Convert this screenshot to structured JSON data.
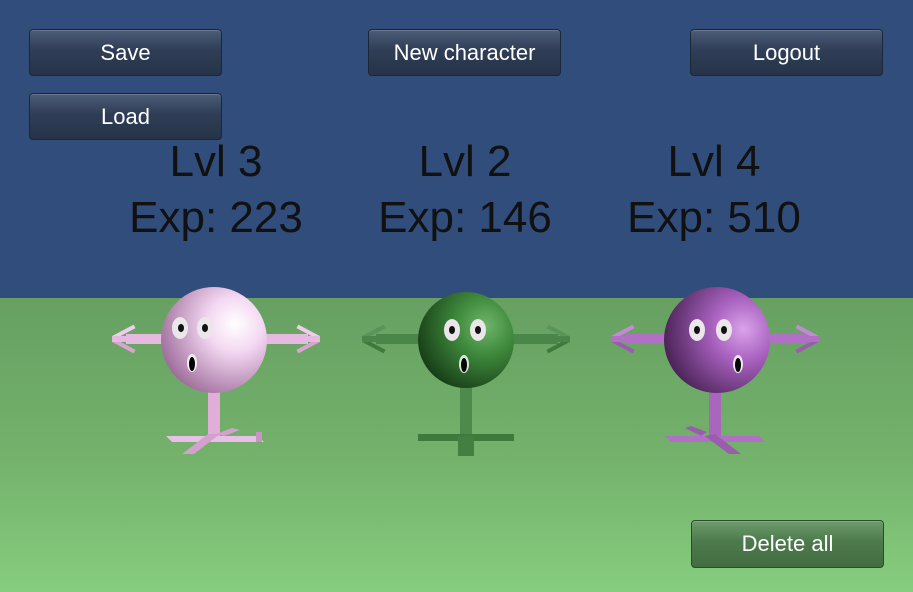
{
  "menu": {
    "save_label": "Save",
    "load_label": "Load",
    "new_character_label": "New character",
    "logout_label": "Logout",
    "delete_all_label": "Delete all"
  },
  "characters": [
    {
      "level": "Lvl 3",
      "exp": "Exp: 223",
      "color": "#e8bfe6",
      "limb_color": "#e0aed9"
    },
    {
      "level": "Lvl 2",
      "exp": "Exp: 146",
      "color": "#3f8a3d",
      "limb_color": "#4d8a4b"
    },
    {
      "level": "Lvl 4",
      "exp": "Exp: 510",
      "color": "#b26cc7",
      "limb_color": "#b070c4"
    }
  ],
  "colors": {
    "sky": "#314d7c",
    "ground": "#74b26c",
    "button_face": "#2f3e56",
    "delete_button_face": "#4d7a4c"
  }
}
